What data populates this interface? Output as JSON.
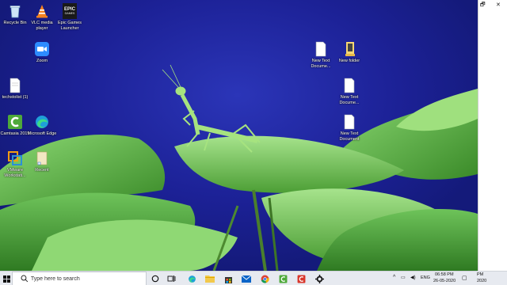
{
  "desktop": {
    "icons": [
      {
        "label": "Recycle Bin",
        "icon": "recycle-bin-icon"
      },
      {
        "label": "VLC media player",
        "icon": "vlc-icon"
      },
      {
        "label": "Epic Games Launcher",
        "icon": "epic-games-icon",
        "logo_text": "EPIC\nGAMES"
      },
      {
        "label": "Zoom",
        "icon": "zoom-icon"
      },
      {
        "label": "New Text Docume...",
        "icon": "text-document-icon"
      },
      {
        "label": "New folder",
        "icon": "folder-icon"
      },
      {
        "label": "techstolist (1)",
        "icon": "text-document-icon"
      },
      {
        "label": "New Text Docume...",
        "icon": "text-document-icon"
      },
      {
        "label": "Camtasia 2019",
        "icon": "camtasia-icon"
      },
      {
        "label": "Microsoft Edge",
        "icon": "edge-icon"
      },
      {
        "label": "New Text Document",
        "icon": "text-document-icon"
      },
      {
        "label": "VMware Workstati...",
        "icon": "vmware-icon"
      },
      {
        "label": "Recent",
        "icon": "shortcut-icon"
      }
    ]
  },
  "window_controls": {
    "restore": "🗗",
    "close": "✕"
  },
  "taskbar": {
    "search_placeholder": "Type here to search",
    "apps": [
      "cortana",
      "task-view",
      "edge",
      "file-explorer",
      "store",
      "mail",
      "chrome",
      "camtasia",
      "camtasia-recorder",
      "settings"
    ],
    "tray": {
      "language": "ENG",
      "time": "06:58 PM",
      "date": "26-05-2020",
      "overflow_time": "PM",
      "overflow_year": "2020"
    }
  },
  "colors": {
    "sky": "#1c2196",
    "leaf_light": "#7fd16a",
    "leaf_dark": "#3f8f2c",
    "taskbar": "#e7eaf0",
    "accent": "#0078d7"
  }
}
